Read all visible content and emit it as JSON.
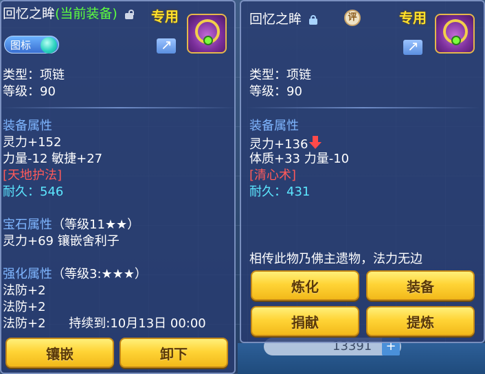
{
  "background": {
    "bottom_number": "13391",
    "bottom_plus": "+"
  },
  "left_panel": {
    "title_name": "回忆之眸",
    "title_status": "(当前装备)",
    "exclusive_label": "专用",
    "toggle_label": "图标",
    "type_line": "类型：项链",
    "level_line": "等级：90",
    "equip_attr_title": "装备属性",
    "stat1": "灵力+152",
    "stat2": "力量-12 敏捷+27",
    "skill": "[天地护法]",
    "durability": "耐久：546",
    "gem_title": "宝石属性",
    "gem_suffix": "（等级11★★）",
    "gem_line": "灵力+69 镶嵌舍利子",
    "enhance_title": "强化属性",
    "enhance_suffix": "（等级3:★★★）",
    "enhance_line1": "法防+2",
    "enhance_line2": "法防+2",
    "enhance_line3_a": "法防+2",
    "enhance_line3_b": "持续到:10月13日 00:00",
    "buttons": {
      "inlay": "镶嵌",
      "unequip": "卸下"
    }
  },
  "right_panel": {
    "title_name": "回忆之眸",
    "evaluate_icon_text": "评",
    "exclusive_label": "专用",
    "type_line": "类型：项链",
    "level_line": "等级：90",
    "equip_attr_title": "装备属性",
    "stat1": "灵力+136",
    "stat2": "体质+33 力量-10",
    "skill": "[清心术]",
    "durability": "耐久：431",
    "description": "相传此物乃佛主遗物，法力无边",
    "buttons": {
      "refine": "炼化",
      "equip": "装备",
      "donate": "捐献",
      "extract": "提炼"
    }
  }
}
